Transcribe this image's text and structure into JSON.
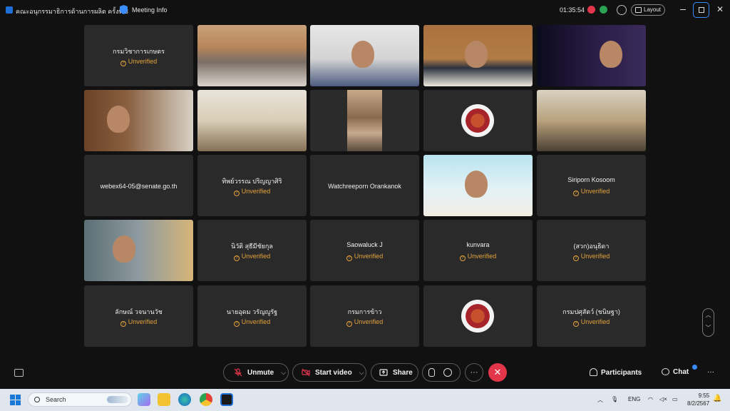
{
  "titlebar": {
    "meeting_title": "คณะอนุกรรมาธิการด้านการผลิต ครั้งที่ 3",
    "meeting_info": "Meeting Info",
    "timer": "01:35:54",
    "layout_label": "Layout",
    "rec_red": "●",
    "rec_green": "●",
    "close": "✕"
  },
  "participants": [
    {
      "name": "กรมวิชาการเกษตร",
      "status": "Unverified"
    },
    {
      "name": "",
      "status": "",
      "video": "meeting-room"
    },
    {
      "name": "",
      "status": "",
      "video": "man-glasses"
    },
    {
      "name": "",
      "status": "",
      "video": "chairman-desk"
    },
    {
      "name": "",
      "status": "",
      "video": "man-dark-room"
    },
    {
      "name": "",
      "status": "",
      "video": "man-office"
    },
    {
      "name": "",
      "status": "",
      "video": "conference-room"
    },
    {
      "name": "",
      "status": "",
      "video": "woman-portrait"
    },
    {
      "name": "",
      "status": "",
      "video": "senate-logo"
    },
    {
      "name": "",
      "status": "",
      "video": "meeting-room-flags"
    },
    {
      "name": "webex64-05@senate.go.th",
      "status": ""
    },
    {
      "name": "ทิพย์วรรณ ปริญญาศิริ",
      "status": "Unverified"
    },
    {
      "name": "Watchreeporn Orankanok",
      "status": ""
    },
    {
      "name": "",
      "status": "",
      "video": "woman-virtual-bg"
    },
    {
      "name": "Siriporn Kosoom",
      "status": "Unverified"
    },
    {
      "name": "",
      "status": "",
      "video": "man-home"
    },
    {
      "name": "นิวัติ สุธีมีชัยกุล",
      "status": "Unverified"
    },
    {
      "name": "Saowaluck J",
      "status": "Unverified"
    },
    {
      "name": "kunvara",
      "status": "Unverified"
    },
    {
      "name": "(สวก)อนุธิดา",
      "status": "Unverified"
    },
    {
      "name": "ลักษณ์ วจนานวัช",
      "status": "Unverified"
    },
    {
      "name": "นายอุดม วรัญญูรัฐ",
      "status": "Unverified"
    },
    {
      "name": "กรมการข้าว",
      "status": "Unverified"
    },
    {
      "name": "",
      "status": "",
      "video": "senate-logo"
    },
    {
      "name": "กรมปศุสัตว์ (ชนิษฐา)",
      "status": "Unverified"
    }
  ],
  "controls": {
    "unmute": "Unmute",
    "start_video": "Start video",
    "share": "Share",
    "more": "···",
    "participants": "Participants",
    "chat": "Chat",
    "overflow": "···"
  },
  "taskbar": {
    "search_placeholder": "Search",
    "language": "ENG",
    "time": "9:55",
    "date": "8/2/2567"
  },
  "colors": {
    "unverified": "#e3a23b",
    "leave": "#e3364a",
    "accent": "#3b8dff"
  }
}
